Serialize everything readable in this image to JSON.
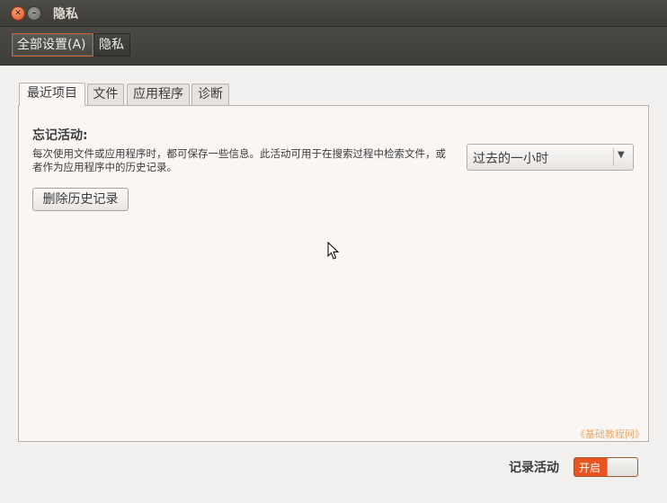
{
  "window": {
    "title": "隐私",
    "close_icon": "close-icon",
    "minimize_icon": "minimize-icon"
  },
  "toolbar": {
    "all_settings_label": "全部设置(A)",
    "privacy_label": "隐私"
  },
  "tabs": [
    {
      "label": "最近项目",
      "active": true
    },
    {
      "label": "文件",
      "active": false
    },
    {
      "label": "应用程序",
      "active": false
    },
    {
      "label": "诊断",
      "active": false
    }
  ],
  "recent": {
    "heading": "忘记活动:",
    "description": "每次使用文件或应用程序时，都可保存一些信息。此活动可用于在搜索过程中检索文件，或者作为应用程序中的历史记录。",
    "delete_button_label": "删除历史记录",
    "duration_select": {
      "value": "过去的一小时",
      "arrow_icon": "dropdown-arrow-icon"
    }
  },
  "watermark": "《基础教程网》",
  "footer": {
    "record_label": "记录活动",
    "toggle_on_label": "开启",
    "toggle_state": "on"
  },
  "colors": {
    "accent": "#e95420",
    "titlebar": "#3f3e3a",
    "panel_bg": "#f9f6f4"
  }
}
